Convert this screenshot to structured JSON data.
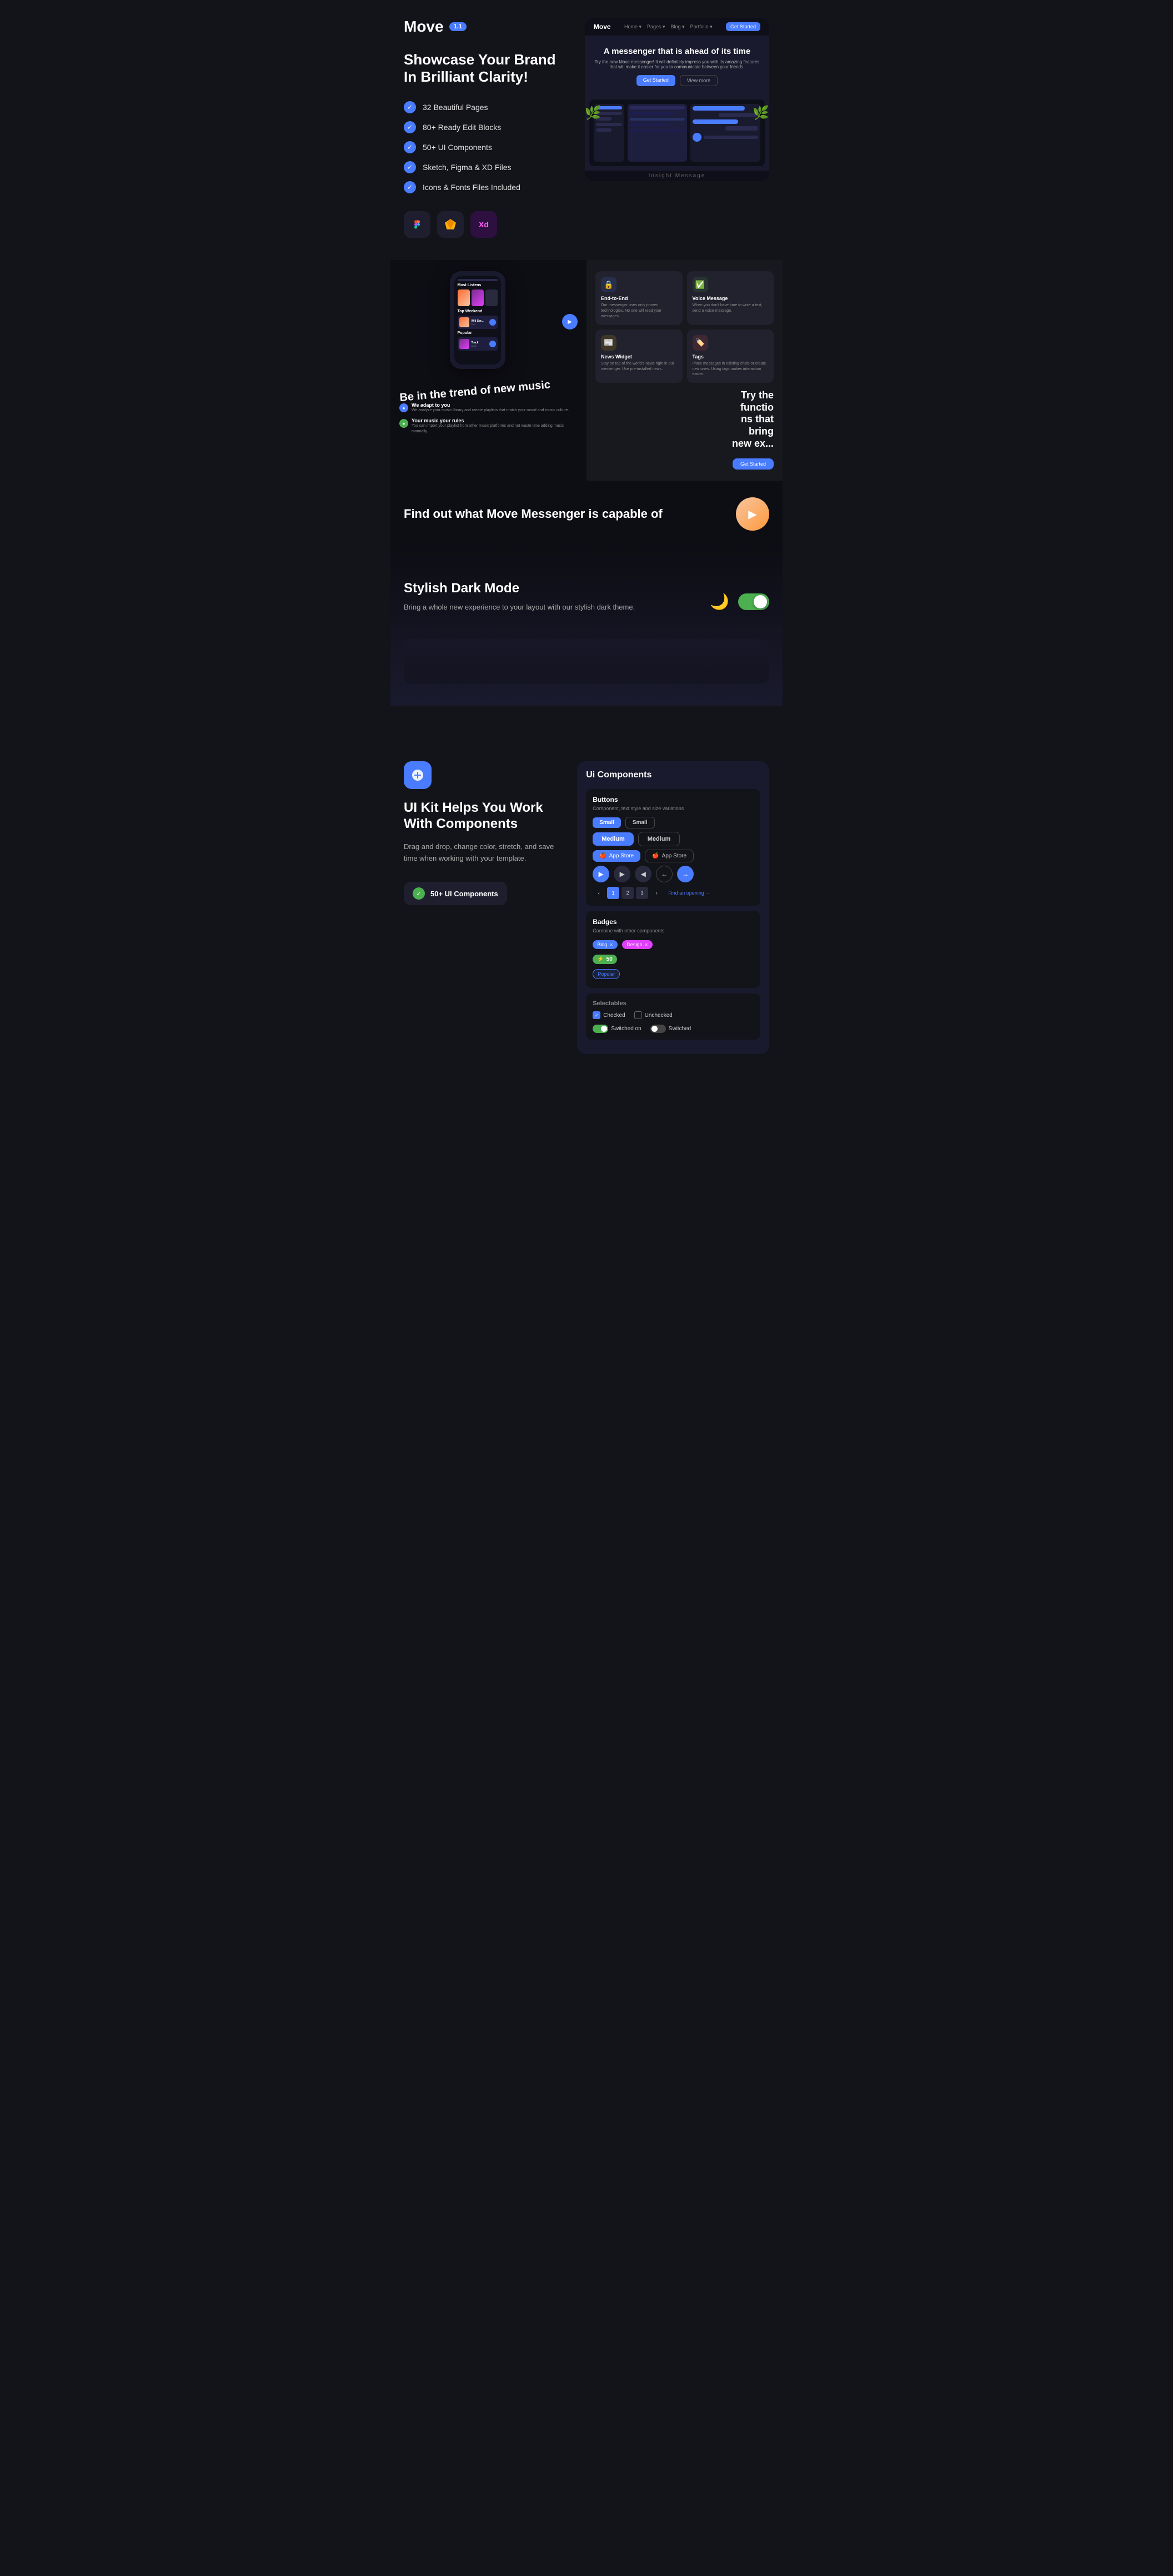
{
  "app": {
    "name": "Move",
    "version": "1.1",
    "tagline": "Showcase Your Brand In Brilliant Clarity!",
    "features": [
      "32 Beautiful Pages",
      "80+ Ready Edit Blocks",
      "50+ UI Components",
      "Sketch, Figma & XD Files",
      "Icons & Fonts Files Included"
    ],
    "tools": [
      "Figma",
      "Sketch",
      "XD"
    ]
  },
  "messenger_section": {
    "nav_logo": "Move",
    "nav_links": [
      "Home",
      "Pages",
      "Blog",
      "Portfolio"
    ],
    "nav_cta": "Get Started",
    "headline": "A messenger that is ahead of its time",
    "subtext": "Try the new Move messenger! It will definitely impress you with its amazing features that will make it easier for you to communicate between your friends.",
    "btn_primary": "Get Started",
    "btn_secondary": "View more",
    "label": "Insight Message"
  },
  "music_section": {
    "headline": "Be in the trend of new music",
    "tracks": [
      {
        "label": "Most Listens"
      },
      {
        "label": "Top Weekend"
      },
      {
        "label": "Popular"
      }
    ],
    "points": [
      {
        "title": "We adapt to you",
        "desc": "We analyze your music library and create playlists that match your mood and music culture."
      },
      {
        "title": "Your music your rules",
        "desc": "You can import your playlist from other music platforms and not waste time adding music manually."
      }
    ]
  },
  "features_section": {
    "try_text": "Try the functions that bring new experience",
    "cards": [
      {
        "icon": "🔒",
        "title": "End-to-End",
        "desc": "Our messenger uses only proven technologies. No one will read your messages.",
        "color": "#4a7cff"
      },
      {
        "icon": "✅",
        "title": "Voice Message",
        "desc": "When you don't have time to write a text, send a voice message.",
        "color": "#4caf50"
      },
      {
        "icon": "📰",
        "title": "News Widget",
        "desc": "Stay on top of the world's news right in our messenger. Use pre-installed news.",
        "color": "#f7c200"
      },
      {
        "icon": "🏷️",
        "title": "Tags",
        "desc": "Place messages in existing chats or create new ones. Using tags makes interaction easier.",
        "color": "#ff5252"
      }
    ],
    "cta": "Get Started"
  },
  "find_section": {
    "text": "Find out what Move Messenger is capable of"
  },
  "dark_mode_section": {
    "title": "Stylish Dark Mode",
    "desc": "Bring a whole new experience to your layout with our stylish dark theme."
  },
  "ui_kit_section": {
    "icon": "🎨",
    "title": "UI Kit Helps You Work With Components",
    "desc": "Drag and drop, change color, stretch, and save time when working with your template.",
    "badge": "50+ UI Components",
    "components_title": "Ui Components",
    "buttons": {
      "label": "Buttons",
      "sublabel": "Component, text style and size variations",
      "small_blue": "Small",
      "small_outline": "Small",
      "medium_blue": "Medium",
      "medium_outline": "Medium",
      "appstore_blue": "App Store",
      "appstore_outline": "App Store"
    },
    "badges": {
      "label": "Badges",
      "sublabel": "Combine with other components",
      "tags": [
        "Blog",
        "Design",
        "50",
        "Popular"
      ]
    },
    "selectables": {
      "label": "Selectables",
      "items": [
        {
          "type": "checkbox",
          "state": "checked",
          "label": "Checked"
        },
        {
          "type": "checkbox",
          "state": "unchecked",
          "label": "Unchecked"
        },
        {
          "type": "toggle",
          "state": "on",
          "label": "Switched on"
        },
        {
          "type": "toggle",
          "state": "off",
          "label": "Switched"
        }
      ]
    }
  }
}
